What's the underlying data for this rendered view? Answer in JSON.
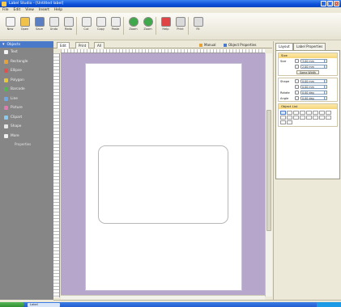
{
  "window": {
    "title": "Label Studio - [Untitled label]",
    "controls": {
      "minimize": "_",
      "maximize": "□",
      "close": "×"
    }
  },
  "menu": [
    "File",
    "Edit",
    "View",
    "Insert",
    "Help"
  ],
  "toolbar": [
    {
      "label": "New",
      "icon": "new-document-icon",
      "color": "#f4f4f4"
    },
    {
      "label": "Open",
      "icon": "open-folder-icon",
      "color": "#f1c24a"
    },
    {
      "label": "Save",
      "icon": "save-disk-icon",
      "color": "#5b7fc4"
    },
    {
      "label": "Undo",
      "icon": "undo-icon",
      "color": "#e8e8e8"
    },
    {
      "label": "Redo",
      "icon": "redo-icon",
      "color": "#e8e8e8"
    },
    {
      "label": "Cut",
      "icon": "cut-icon",
      "color": "#ececec"
    },
    {
      "label": "Copy",
      "icon": "copy-icon",
      "color": "#ececec"
    },
    {
      "label": "Paste",
      "icon": "paste-icon",
      "color": "#ececec"
    },
    {
      "label": "Zoom",
      "icon": "zoom-in-icon",
      "color": "#3fa84a"
    },
    {
      "label": "Zoom",
      "icon": "zoom-out-icon",
      "color": "#3fa84a"
    },
    {
      "label": "Help",
      "icon": "help-icon",
      "color": "#e04444"
    },
    {
      "label": "Print",
      "icon": "print-icon",
      "color": "#d9d9d9"
    },
    {
      "label": "Fit",
      "icon": "fit-page-icon",
      "color": "#dcdcdc"
    }
  ],
  "left_panel": {
    "header": "Objects",
    "items": [
      {
        "label": "Text",
        "color": "#f4f4f4"
      },
      {
        "label": "Rectangle",
        "color": "#e6a23a"
      },
      {
        "label": "Ellipse",
        "color": "#e05252"
      },
      {
        "label": "Polygon",
        "color": "#e6c73a"
      },
      {
        "label": "Barcode",
        "color": "#55b455"
      },
      {
        "label": "Line",
        "color": "#6fa8e6"
      },
      {
        "label": "Picture",
        "color": "#e07ab0"
      },
      {
        "label": "Clipart",
        "color": "#8ac9f0"
      },
      {
        "label": "Shape",
        "color": "#e6e6e6"
      },
      {
        "label": "More",
        "color": "#f0f0f0"
      }
    ],
    "sub_item": "Properties"
  },
  "doc_tabs": [
    {
      "label": "Edit",
      "active": true
    },
    {
      "label": "Print",
      "active": false
    },
    {
      "label": "All",
      "active": false
    }
  ],
  "doc_tabs_right": [
    {
      "label": "Manual"
    },
    {
      "label": "Object Properties"
    }
  ],
  "right_panel": {
    "tabs": [
      {
        "label": "Layout",
        "active": true
      },
      {
        "label": "Label Properties",
        "active": false
      }
    ],
    "size_group": {
      "title": "Size",
      "rows": [
        {
          "label": "Size",
          "value": "3.00 mm"
        },
        {
          "label": "",
          "value": "2.00 mm"
        },
        {
          "label": "",
          "value": "Same Width",
          "button": true
        }
      ]
    },
    "position_group": {
      "rows": [
        {
          "label": "Shape",
          "value": "0.00 mm"
        },
        {
          "label": "",
          "value": "0.00 mm"
        },
        {
          "label": "Rotate",
          "value": "0.00 deg"
        },
        {
          "label": "Angle",
          "value": "0.00 deg"
        }
      ]
    },
    "objects_group": {
      "title": "Object List",
      "cells": 18
    }
  },
  "taskbar": {
    "task_label": "Label"
  },
  "colors": {
    "canvas_bg": "#b7a6cc",
    "left_panel": "#868686",
    "selected_tab": "#4a79c9"
  }
}
